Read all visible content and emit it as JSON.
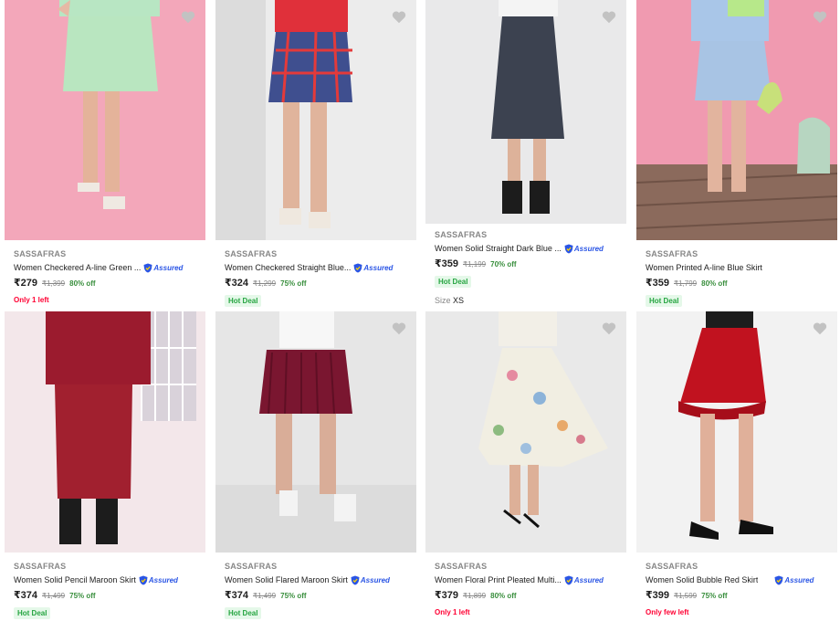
{
  "assured_label": "Assured",
  "colors": {
    "price_off": "#388e3c",
    "hot_deal_text": "#26a541",
    "hot_deal_bg": "#e5f8e9",
    "stock_warn": "#ff0033",
    "assured_blue": "#2a55e5",
    "wishlist_heart": "#c2c2c2"
  },
  "products": [
    {
      "brand": "SASSAFRAS",
      "title": "Women Checkered A-line Green ...",
      "assured": true,
      "price": "₹279",
      "mrp": "₹1,399",
      "off": "80% off",
      "stock": "Only 1 left",
      "deal": "",
      "size_label": "",
      "size_value": ""
    },
    {
      "brand": "SASSAFRAS",
      "title": "Women Checkered Straight Blue...",
      "assured": true,
      "price": "₹324",
      "mrp": "₹1,299",
      "off": "75% off",
      "stock": "",
      "deal": "Hot Deal",
      "size_label": "",
      "size_value": ""
    },
    {
      "brand": "SASSAFRAS",
      "title": "Women Solid Straight Dark Blue ...",
      "assured": true,
      "price": "₹359",
      "mrp": "₹1,199",
      "off": "70% off",
      "stock": "",
      "deal": "Hot Deal",
      "size_label": "Size",
      "size_value": "XS"
    },
    {
      "brand": "SASSAFRAS",
      "title": "Women Printed A-line Blue Skirt",
      "assured": false,
      "price": "₹359",
      "mrp": "₹1,799",
      "off": "80% off",
      "stock": "",
      "deal": "Hot Deal",
      "size_label": "",
      "size_value": ""
    },
    {
      "brand": "SASSAFRAS",
      "title": "Women Solid Pencil Maroon Skirt",
      "assured": true,
      "price": "₹374",
      "mrp": "₹1,499",
      "off": "75% off",
      "stock": "",
      "deal": "Hot Deal",
      "size_label": "",
      "size_value": ""
    },
    {
      "brand": "SASSAFRAS",
      "title": "Women Solid Flared Maroon Skirt",
      "assured": true,
      "price": "₹374",
      "mrp": "₹1,499",
      "off": "75% off",
      "stock": "",
      "deal": "Hot Deal",
      "size_label": "",
      "size_value": ""
    },
    {
      "brand": "SASSAFRAS",
      "title": "Women Floral Print Pleated Multi...",
      "assured": true,
      "price": "₹379",
      "mrp": "₹1,899",
      "off": "80% off",
      "stock": "Only 1 left",
      "deal": "",
      "size_label": "",
      "size_value": ""
    },
    {
      "brand": "SASSAFRAS",
      "title": "Women Solid Bubble Red Skirt",
      "assured": true,
      "price": "₹399",
      "mrp": "₹1,599",
      "off": "75% off",
      "stock": "Only few left",
      "deal": "",
      "size_label": "",
      "size_value": ""
    }
  ]
}
